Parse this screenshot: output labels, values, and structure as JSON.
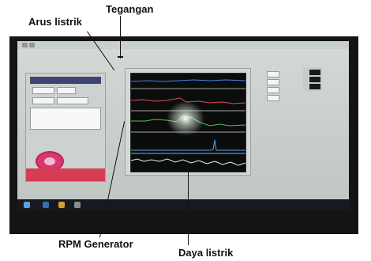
{
  "annotations": {
    "tegangan": "Tegangan",
    "arus": "Arus listrik",
    "rpm": "RPM Generator",
    "daya": "Daya listrik"
  },
  "app": {
    "left_panel": {
      "header": "",
      "fields": [
        {
          "label": "",
          "value": ""
        },
        {
          "label": "",
          "value": ""
        }
      ],
      "textbox": "",
      "stop_label": ""
    },
    "graph": {
      "title": "",
      "legend": [
        "",
        "",
        "",
        ""
      ]
    }
  },
  "plot_series_colors": {
    "tegangan": "#4d7fe0",
    "arus": "#e05050",
    "rpm": "#4ec45e",
    "daya": "#eeeeee",
    "spike": "#4aa6ff"
  },
  "taskbar": {
    "tray": ""
  }
}
